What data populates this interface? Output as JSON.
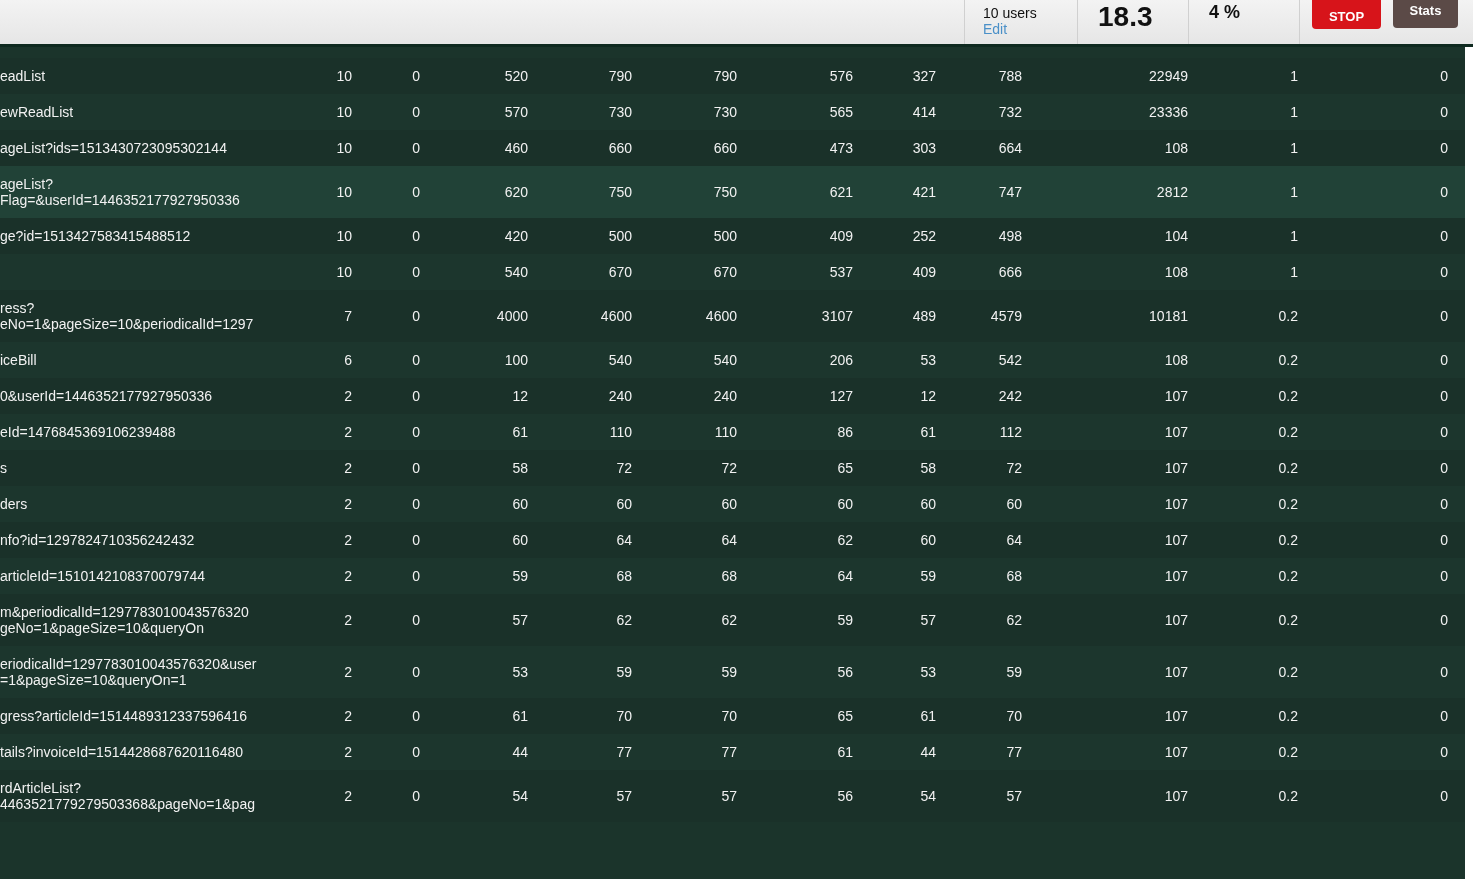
{
  "header": {
    "users": "10 users",
    "edit_link": "Edit",
    "rps": "18.3",
    "failures": "4 %",
    "stop_button": "STOP",
    "stats_button": "Stats"
  },
  "rows": [
    {
      "name": [
        "eadList"
      ],
      "cells": [
        "10",
        "0",
        "520",
        "790",
        "790",
        "576",
        "327",
        "788",
        "22949",
        "1",
        "0"
      ],
      "highlighted": false
    },
    {
      "name": [
        "ewReadList"
      ],
      "cells": [
        "10",
        "0",
        "570",
        "730",
        "730",
        "565",
        "414",
        "732",
        "23336",
        "1",
        "0"
      ],
      "highlighted": false
    },
    {
      "name": [
        "ageList?ids=1513430723095302144"
      ],
      "cells": [
        "10",
        "0",
        "460",
        "660",
        "660",
        "473",
        "303",
        "664",
        "108",
        "1",
        "0"
      ],
      "highlighted": false
    },
    {
      "name": [
        "ageList?",
        "Flag=&userId=1446352177927950336"
      ],
      "cells": [
        "10",
        "0",
        "620",
        "750",
        "750",
        "621",
        "421",
        "747",
        "2812",
        "1",
        "0"
      ],
      "highlighted": true
    },
    {
      "name": [
        "ge?id=1513427583415488512"
      ],
      "cells": [
        "10",
        "0",
        "420",
        "500",
        "500",
        "409",
        "252",
        "498",
        "104",
        "1",
        "0"
      ],
      "highlighted": false
    },
    {
      "name": [],
      "cells": [
        "10",
        "0",
        "540",
        "670",
        "670",
        "537",
        "409",
        "666",
        "108",
        "1",
        "0"
      ],
      "highlighted": false
    },
    {
      "name": [
        "ress?",
        "eNo=1&pageSize=10&periodicalId=1297"
      ],
      "cells": [
        "7",
        "0",
        "4000",
        "4600",
        "4600",
        "3107",
        "489",
        "4579",
        "10181",
        "0.2",
        "0"
      ],
      "highlighted": false
    },
    {
      "name": [
        "iceBill"
      ],
      "cells": [
        "6",
        "0",
        "100",
        "540",
        "540",
        "206",
        "53",
        "542",
        "108",
        "0.2",
        "0"
      ],
      "highlighted": false
    },
    {
      "name": [
        "0&userId=1446352177927950336"
      ],
      "cells": [
        "2",
        "0",
        "12",
        "240",
        "240",
        "127",
        "12",
        "242",
        "107",
        "0.2",
        "0"
      ],
      "highlighted": false
    },
    {
      "name": [
        "eId=1476845369106239488"
      ],
      "cells": [
        "2",
        "0",
        "61",
        "110",
        "110",
        "86",
        "61",
        "112",
        "107",
        "0.2",
        "0"
      ],
      "highlighted": false
    },
    {
      "name": [
        "s"
      ],
      "cells": [
        "2",
        "0",
        "58",
        "72",
        "72",
        "65",
        "58",
        "72",
        "107",
        "0.2",
        "0"
      ],
      "highlighted": false
    },
    {
      "name": [
        "ders"
      ],
      "cells": [
        "2",
        "0",
        "60",
        "60",
        "60",
        "60",
        "60",
        "60",
        "107",
        "0.2",
        "0"
      ],
      "highlighted": false
    },
    {
      "name": [
        "nfo?id=1297824710356242432"
      ],
      "cells": [
        "2",
        "0",
        "60",
        "64",
        "64",
        "62",
        "60",
        "64",
        "107",
        "0.2",
        "0"
      ],
      "highlighted": false
    },
    {
      "name": [
        "articleId=1510142108370079744"
      ],
      "cells": [
        "2",
        "0",
        "59",
        "68",
        "68",
        "64",
        "59",
        "68",
        "107",
        "0.2",
        "0"
      ],
      "highlighted": false
    },
    {
      "name": [
        "m&periodicalId=1297783010043576320",
        "geNo=1&pageSize=10&queryOn"
      ],
      "cells": [
        "2",
        "0",
        "57",
        "62",
        "62",
        "59",
        "57",
        "62",
        "107",
        "0.2",
        "0"
      ],
      "highlighted": false
    },
    {
      "name": [
        "eriodicalId=1297783010043576320&user",
        "=1&pageSize=10&queryOn=1"
      ],
      "cells": [
        "2",
        "0",
        "53",
        "59",
        "59",
        "56",
        "53",
        "59",
        "107",
        "0.2",
        "0"
      ],
      "highlighted": false
    },
    {
      "name": [
        "gress?articleId=1514489312337596416"
      ],
      "cells": [
        "2",
        "0",
        "61",
        "70",
        "70",
        "65",
        "61",
        "70",
        "107",
        "0.2",
        "0"
      ],
      "highlighted": false
    },
    {
      "name": [
        "tails?invoiceId=1514428687620116480"
      ],
      "cells": [
        "2",
        "0",
        "44",
        "77",
        "77",
        "61",
        "44",
        "77",
        "107",
        "0.2",
        "0"
      ],
      "highlighted": false
    },
    {
      "name": [
        "rdArticleList?",
        "4463521779279503368&pageNo=1&pag"
      ],
      "cells": [
        "2",
        "0",
        "54",
        "57",
        "57",
        "56",
        "54",
        "57",
        "107",
        "0.2",
        "0"
      ],
      "highlighted": false
    }
  ]
}
